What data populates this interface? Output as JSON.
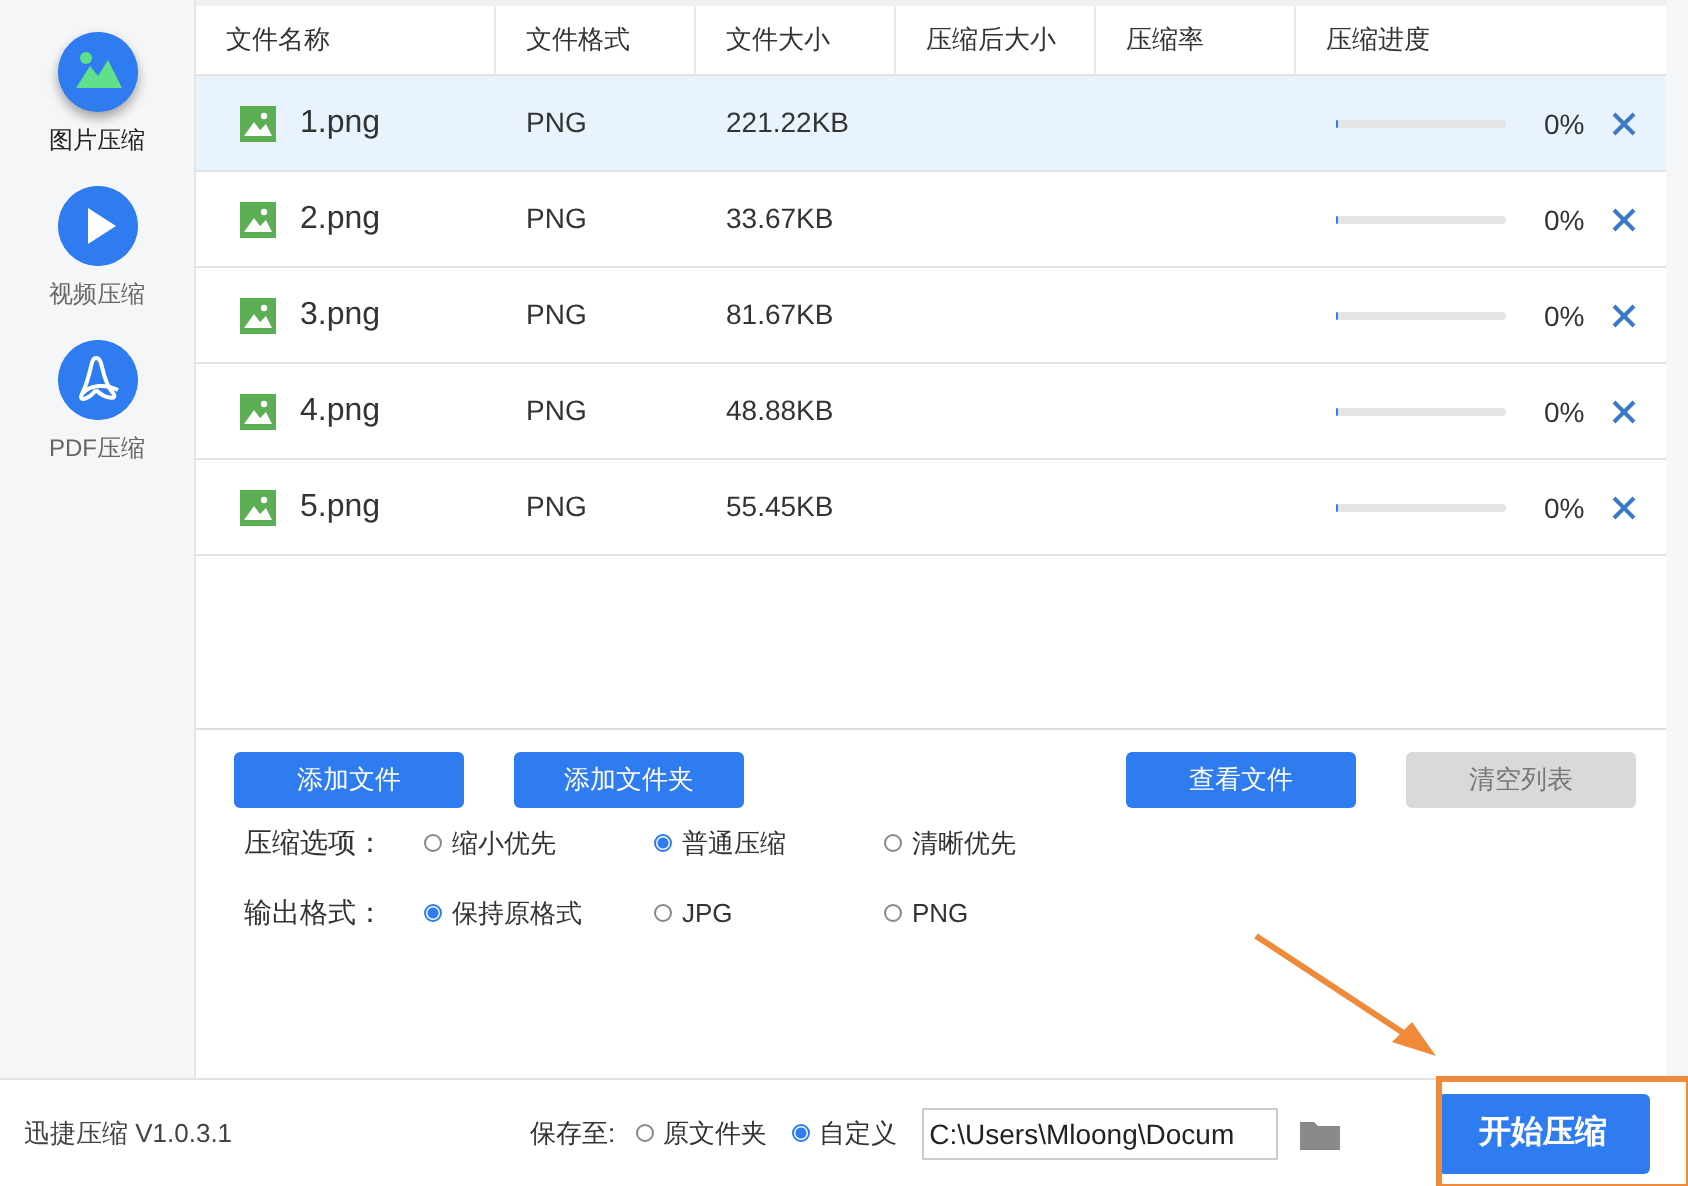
{
  "sidebar": {
    "items": [
      {
        "kind": "image",
        "label": "图片压缩",
        "selected": true
      },
      {
        "kind": "video",
        "label": "视频压缩",
        "selected": false
      },
      {
        "kind": "pdf",
        "label": "PDF压缩",
        "selected": false
      }
    ]
  },
  "table": {
    "columns": [
      "文件名称",
      "文件格式",
      "文件大小",
      "压缩后大小",
      "压缩率",
      "压缩进度"
    ],
    "rows": [
      {
        "name": "1.png",
        "format": "PNG",
        "size": "221.22KB",
        "level": 0,
        "progress": "0%",
        "selected": true
      },
      {
        "name": "2.png",
        "format": "PNG",
        "size": "33.67KB",
        "level": 0,
        "progress": "0%",
        "selected": false
      },
      {
        "name": "3.png",
        "format": "PNG",
        "size": "81.67KB",
        "level": 0,
        "progress": "0%",
        "selected": false
      },
      {
        "name": "4.png",
        "format": "PNG",
        "size": "48.88KB",
        "level": 0,
        "progress": "0%",
        "selected": false
      },
      {
        "name": "5.png",
        "format": "PNG",
        "size": "55.45KB",
        "level": 0,
        "progress": "0%",
        "selected": false
      }
    ]
  },
  "buttons": [
    {
      "label": "添加文件",
      "disabled": false
    },
    {
      "label": "添加文件夹",
      "disabled": false
    },
    {
      "label": "查看文件",
      "disabled": false
    },
    {
      "label": "清空列表",
      "disabled": true
    }
  ],
  "options": [
    {
      "label": "压缩选项：",
      "choices": [
        {
          "label": "缩小优先",
          "selected": false
        },
        {
          "label": "普通压缩",
          "selected": true
        },
        {
          "label": "清晰优先",
          "selected": false
        }
      ]
    },
    {
      "label": "输出格式：",
      "choices": [
        {
          "label": "保持原格式",
          "selected": true
        },
        {
          "label": "JPG",
          "selected": false
        },
        {
          "label": "PNG",
          "selected": false
        }
      ]
    }
  ],
  "footer": {
    "version": "迅捷压缩 V1.0.3.1",
    "save_label": "保存至:",
    "save_choices": [
      {
        "label": "原文件夹",
        "selected": false
      },
      {
        "label": "自定义",
        "selected": true
      }
    ],
    "path": "C:\\Users\\Mloong\\Docum",
    "start_button": "开始压缩"
  },
  "annotation": {
    "arrow": true,
    "highlight": true
  }
}
